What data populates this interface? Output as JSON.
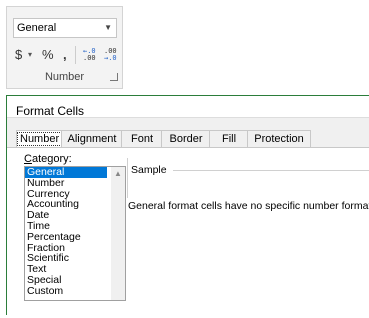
{
  "ribbon": {
    "number_format_value": "General",
    "currency_symbol": "$",
    "percent_symbol": "%",
    "comma_symbol": ",",
    "increase_decimal_top": "←.0",
    "increase_decimal_bottom": ".00",
    "decrease_decimal_top": ".00",
    "decrease_decimal_bottom": "→.0",
    "group_label": "Number"
  },
  "dialog": {
    "title": "Format Cells",
    "tabs": [
      {
        "label": "Number"
      },
      {
        "label": "Alignment"
      },
      {
        "label": "Font"
      },
      {
        "label": "Border"
      },
      {
        "label": "Fill"
      },
      {
        "label": "Protection"
      }
    ],
    "category_label_first": "C",
    "category_label_rest": "ategory:",
    "categories": [
      "General",
      "Number",
      "Currency",
      "Accounting",
      "Date",
      "Time",
      "Percentage",
      "Fraction",
      "Scientific",
      "Text",
      "Special",
      "Custom"
    ],
    "sample_label": "Sample",
    "description": "General format cells have no specific number format."
  }
}
